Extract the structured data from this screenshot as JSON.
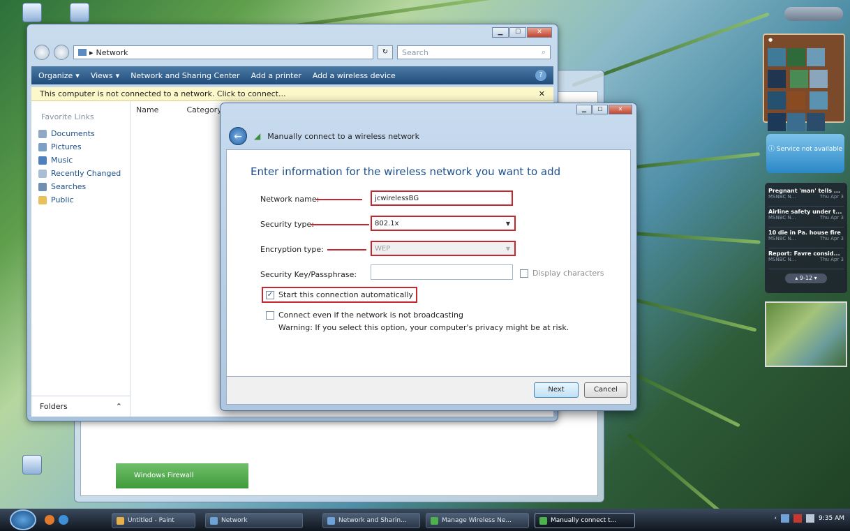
{
  "explorer": {
    "address": "Network",
    "search_placeholder": "Search",
    "toolbar": {
      "organize": "Organize",
      "views": "Views",
      "network_center": "Network and Sharing Center",
      "add_printer": "Add a printer",
      "add_wireless": "Add a wireless device"
    },
    "infobar_text": "This computer is not connected to a network. Click to connect...",
    "favorite_links_title": "Favorite Links",
    "favorite_links": [
      "Documents",
      "Pictures",
      "Music",
      "Recently Changed",
      "Searches",
      "Public"
    ],
    "columns": [
      "Name",
      "Category"
    ],
    "folders_label": "Folders"
  },
  "back_window": {
    "firewall_label": "Windows Firewall"
  },
  "wizard": {
    "title": "Manually connect to a wireless network",
    "heading": "Enter information for the wireless network you want to add",
    "network_name_label": "Network name:",
    "network_name_value": "jcwirelessBG",
    "security_type_label": "Security type:",
    "security_type_value": "802.1x",
    "encryption_type_label": "Encryption type:",
    "encryption_type_value": "WEP",
    "security_key_label": "Security Key/Passphrase:",
    "security_key_value": "",
    "display_characters_label": "Display characters",
    "start_auto_label": "Start this connection automatically",
    "start_auto_checked": true,
    "connect_hidden_label": "Connect even if the network is not broadcasting",
    "connect_hidden_checked": false,
    "warning_text": "Warning: If you select this option, your computer's privacy might be at risk.",
    "next_button": "Next",
    "cancel_button": "Cancel"
  },
  "gadgets": {
    "weather_text": "Service not available",
    "feeds": [
      {
        "title": "Pregnant 'man' tells ...",
        "source": "MSNBC N...",
        "date": "Thu Apr 3"
      },
      {
        "title": "Airline safety under t...",
        "source": "MSNBC N...",
        "date": "Thu Apr 3"
      },
      {
        "title": "10 die in Pa. house fire",
        "source": "MSNBC N...",
        "date": "Thu Apr 3"
      },
      {
        "title": "Report: Favre consid...",
        "source": "MSNBC N...",
        "date": "Thu Apr 3"
      }
    ],
    "feed_pager": "9-12"
  },
  "taskbar": {
    "items": [
      "Untitled - Paint",
      "Network",
      "Network and Sharin...",
      "Manage Wireless Ne...",
      "Manually connect t..."
    ],
    "clock": "9:35 AM"
  },
  "colors": {
    "highlight_red": "#c6262e",
    "vista_blue": "#1e4f8c",
    "infobar_yellow": "#fcf8c9"
  }
}
